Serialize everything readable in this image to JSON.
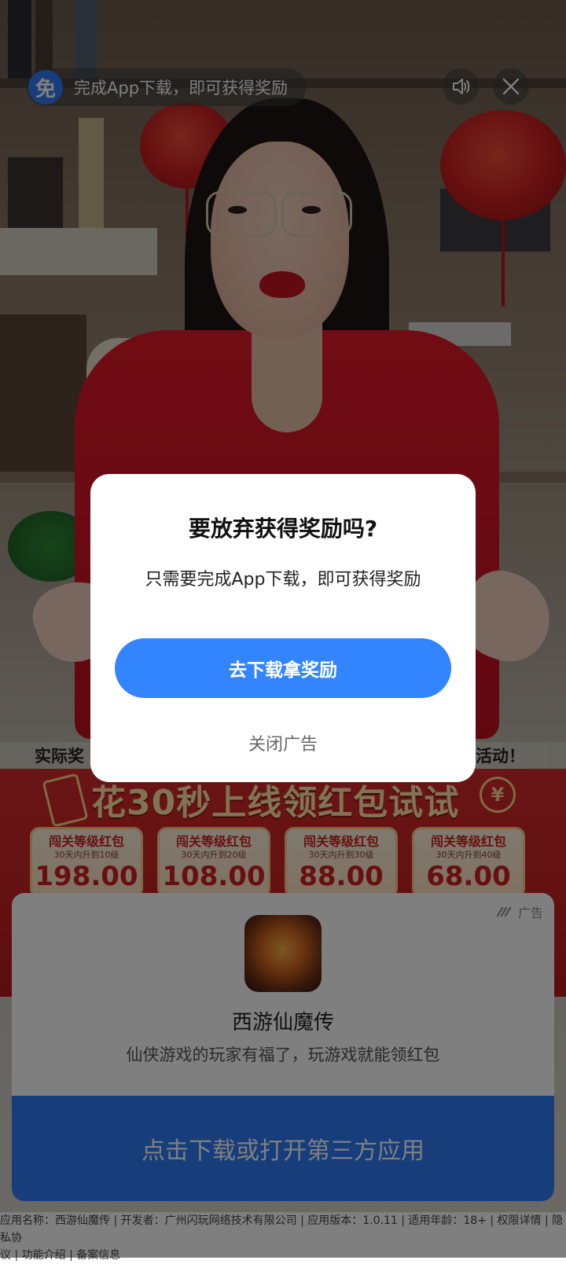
{
  "top_bar": {
    "badge_text": "免",
    "reward_text": "完成App下载，即可获得奖励",
    "sound_icon": "speaker-icon",
    "close_icon": "close-icon"
  },
  "promo": {
    "caption_left": "实际奖",
    "caption_right": "人活动！",
    "title": "花30秒上线领红包试试",
    "coin_symbol": "¥",
    "cards": [
      {
        "title": "闯关等级红包",
        "sub": "30天内升到10级",
        "amount": "198.00"
      },
      {
        "title": "闯关等级红包",
        "sub": "30天内升到20级",
        "amount": "108.00"
      },
      {
        "title": "闯关等级红包",
        "sub": "30天内升到30级",
        "amount": "88.00"
      },
      {
        "title": "闯关等级红包",
        "sub": "30天内升到40级",
        "amount": "68.00"
      }
    ]
  },
  "app_card": {
    "ad_label": "广告",
    "app_name": "西游仙魔传",
    "app_desc": "仙侠游戏的玩家有福了，玩游戏就能领红包",
    "download_label": "点击下载或打开第三方应用"
  },
  "footer": {
    "line1": "应用名称：西游仙魔传 | 开发者：广州闪玩网络技术有限公司 | 应用版本：1.0.11 | 适用年龄：18+ | 权限详情 | 隐私协",
    "line2": "议 | 功能介绍 | 备案信息"
  },
  "dialog": {
    "title": "要放弃获得奖励吗?",
    "message": "只需要完成App下载，即可获得奖励",
    "primary_label": "去下载拿奖励",
    "secondary_label": "关闭广告"
  },
  "colors": {
    "accent": "#3385ff",
    "download_blue": "#2f7cf6",
    "promo_red": "#d62b2b"
  }
}
